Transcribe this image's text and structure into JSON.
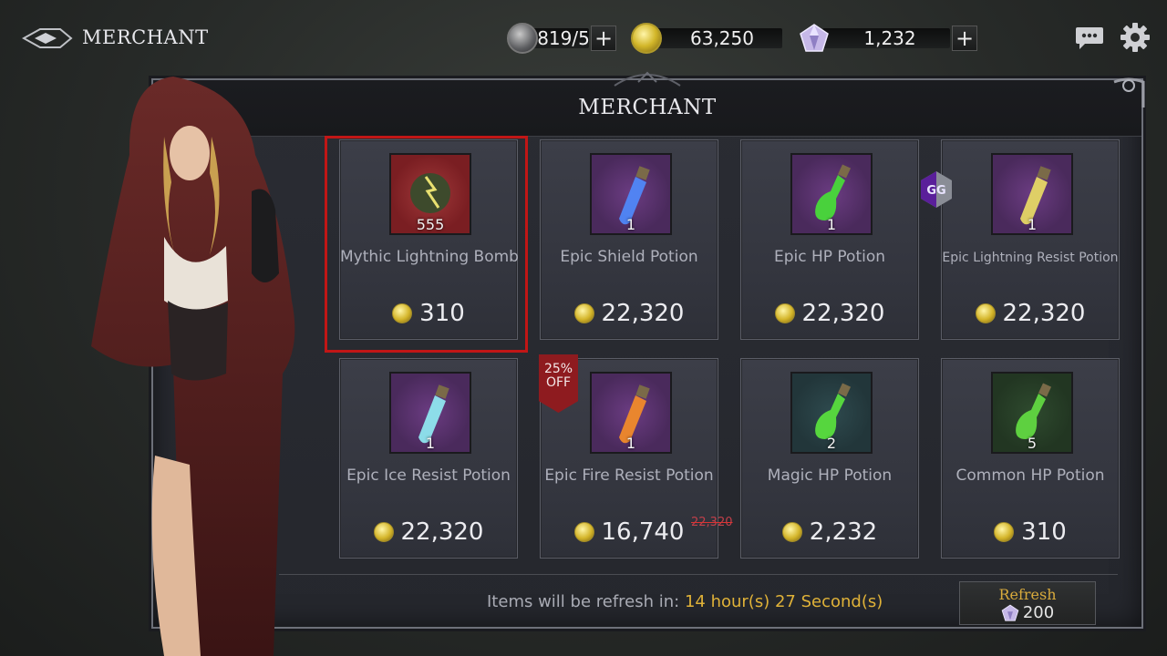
{
  "topbar": {
    "title": "MERCHANT",
    "stamina": "819/5",
    "gold": "63,250",
    "gems": "1,232",
    "plus": "+"
  },
  "panel": {
    "title": "MERCHANT"
  },
  "items": [
    {
      "name": "Mythic Lightning Bomb",
      "qty": "555",
      "price": "310",
      "icon": "lightning-bomb-icon",
      "bg": "#7a1e22",
      "accent": "#b9b34a"
    },
    {
      "name": "Epic Shield Potion",
      "qty": "1",
      "price": "22,320",
      "icon": "shield-potion-icon",
      "bg": "#4a2a5c",
      "accent": "#4f8cff"
    },
    {
      "name": "Epic HP Potion",
      "qty": "1",
      "price": "22,320",
      "icon": "hp-potion-icon",
      "bg": "#4a2a5c",
      "accent": "#49d13c"
    },
    {
      "name": "Epic Lightning Resist Potion",
      "qty": "1",
      "price": "22,320",
      "icon": "lightning-resist-potion-icon",
      "bg": "#4a2a5c",
      "accent": "#e6d765"
    },
    {
      "name": "Epic Ice Resist Potion",
      "qty": "1",
      "price": "22,320",
      "icon": "ice-resist-potion-icon",
      "bg": "#4a2a5c",
      "accent": "#8fe6ef"
    },
    {
      "name": "Epic Fire Resist Potion",
      "qty": "1",
      "price": "16,740",
      "old_price": "22,320",
      "icon": "fire-resist-potion-icon",
      "bg": "#4a2a5c",
      "accent": "#f08a2a"
    },
    {
      "name": "Magic HP Potion",
      "qty": "2",
      "price": "2,232",
      "icon": "magic-hp-potion-icon",
      "bg": "#22363a",
      "accent": "#56d63e"
    },
    {
      "name": "Common HP Potion",
      "qty": "5",
      "price": "310",
      "icon": "common-hp-potion-icon",
      "bg": "#223622",
      "accent": "#5ed040"
    }
  ],
  "discount": {
    "line1": "25%",
    "line2": "OFF"
  },
  "gg_badge": "GG",
  "refresh": {
    "prefix": "Items will be refresh in:",
    "time": "14 hour(s) 27 Second(s)",
    "button_label": "Refresh",
    "cost": "200"
  },
  "colors": {
    "selected_border": "#c11616",
    "time_text": "#e0b238",
    "discount_bg": "#8e1b1f"
  }
}
